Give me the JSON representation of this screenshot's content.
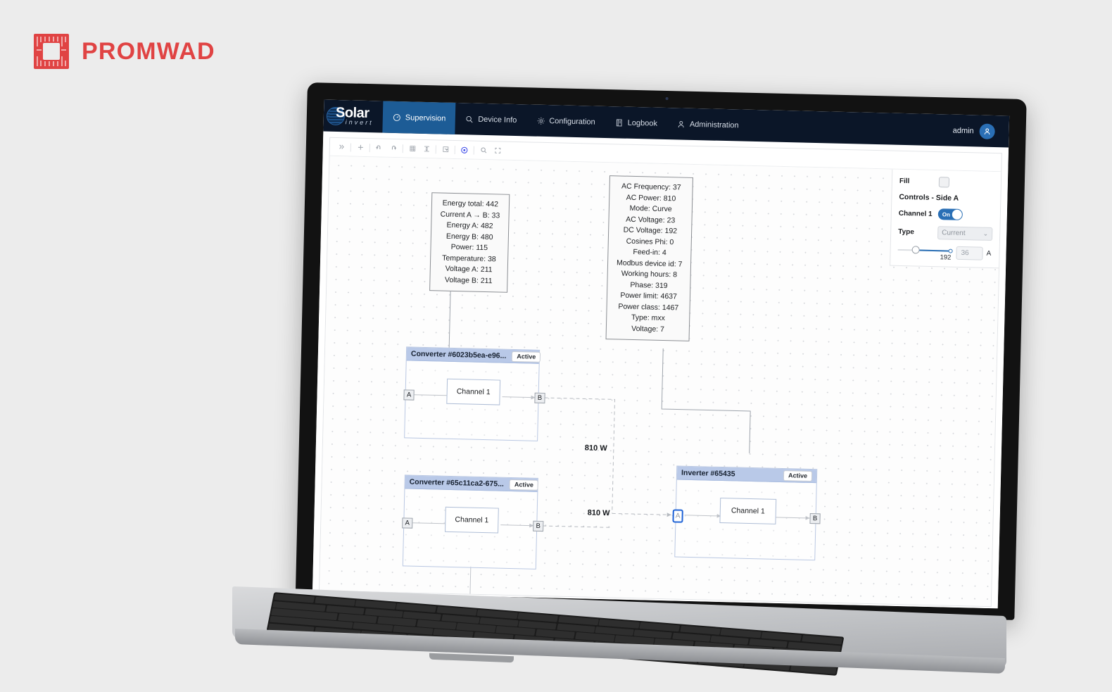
{
  "brand": {
    "promwad_word": "PROMWAD",
    "promwad_mark_icon": "circuit-board-icon",
    "accent_red": "#e04343"
  },
  "app": {
    "logo_primary": "Solar",
    "logo_secondary": "invert",
    "logo_icon": "sun-globe-icon",
    "accent_blue": "#1d5c96",
    "topbar_bg": "#0b1628"
  },
  "nav": {
    "items": [
      {
        "label": "Supervision",
        "icon": "gauge-icon",
        "active": true
      },
      {
        "label": "Device Info",
        "icon": "search-icon",
        "active": false
      },
      {
        "label": "Configuration",
        "icon": "gear-icon",
        "active": false
      },
      {
        "label": "Logbook",
        "icon": "book-icon",
        "active": false
      },
      {
        "label": "Administration",
        "icon": "person-icon",
        "active": false
      }
    ]
  },
  "user": {
    "name": "admin",
    "avatar_icon": "person-icon"
  },
  "toolbar": {
    "buttons": [
      {
        "name": "expand-panel-icon",
        "glyph": "chevron-double-right",
        "active": false
      },
      {
        "name": "add-node-icon",
        "glyph": "plus",
        "active": false
      },
      {
        "name": "undo-icon",
        "glyph": "undo-arrow",
        "active": false
      },
      {
        "name": "redo-icon",
        "glyph": "redo-arrow",
        "active": false
      },
      {
        "name": "grid-layout-icon",
        "glyph": "grid",
        "active": false
      },
      {
        "name": "collapse-all-icon",
        "glyph": "collapse-vertical",
        "active": false
      },
      {
        "name": "select-area-icon",
        "glyph": "selection-box",
        "active": false
      },
      {
        "name": "focus-target-icon",
        "glyph": "target-circle",
        "active": true
      },
      {
        "name": "zoom-icon",
        "glyph": "magnifier",
        "active": false
      },
      {
        "name": "fullscreen-icon",
        "glyph": "expand-corners",
        "active": false
      }
    ]
  },
  "tooltips": [
    {
      "name": "converter-metrics-tooltip",
      "lines": [
        "Energy total: 442",
        "Current A → B: 33",
        "Energy A: 482",
        "Energy B: 480",
        "Power: 115",
        "Temperature: 38",
        "Voltage A: 211",
        "Voltage B: 211"
      ]
    },
    {
      "name": "inverter-metrics-tooltip",
      "lines": [
        "AC Frequency: 37",
        "AC Power: 810",
        "Mode: Curve",
        "AC Voltage: 23",
        "DC Voltage: 192",
        "Cosines Phi: 0",
        "Feed-in: 4",
        "Modbus device id: 7",
        "Working hours: 8",
        "Phase: 319",
        "Power limit: 4637",
        "Power class: 1467",
        "Type: mxx",
        "Voltage: 7"
      ]
    }
  ],
  "nodes": [
    {
      "name": "converter-node-1",
      "title": "Converter #6023b5ea-e96...",
      "status": "Active",
      "channel": "Channel 1",
      "port_in": "A",
      "port_out": "B",
      "port_in_selected": false
    },
    {
      "name": "converter-node-2",
      "title": "Converter #65c11ca2-675...",
      "status": "Active",
      "channel": "Channel 1",
      "port_in": "A",
      "port_out": "B",
      "port_in_selected": false
    },
    {
      "name": "inverter-node",
      "title": "Inverter #65435",
      "status": "Active",
      "channel": "Channel 1",
      "port_in": "A",
      "port_out": "B",
      "port_in_selected": true
    }
  ],
  "edges": [
    {
      "name": "edge-label-upper",
      "label": "810 W"
    },
    {
      "name": "edge-label-lower",
      "label": "810 W"
    }
  ],
  "inspector": {
    "fill_label": "Fill",
    "fill_checked": false,
    "section_title": "Controls - Side A",
    "channel_label": "Channel 1",
    "channel_state": "On",
    "type_label": "Type",
    "type_value": "Current",
    "slider_value": "192",
    "input_value": "36",
    "unit": "A"
  }
}
